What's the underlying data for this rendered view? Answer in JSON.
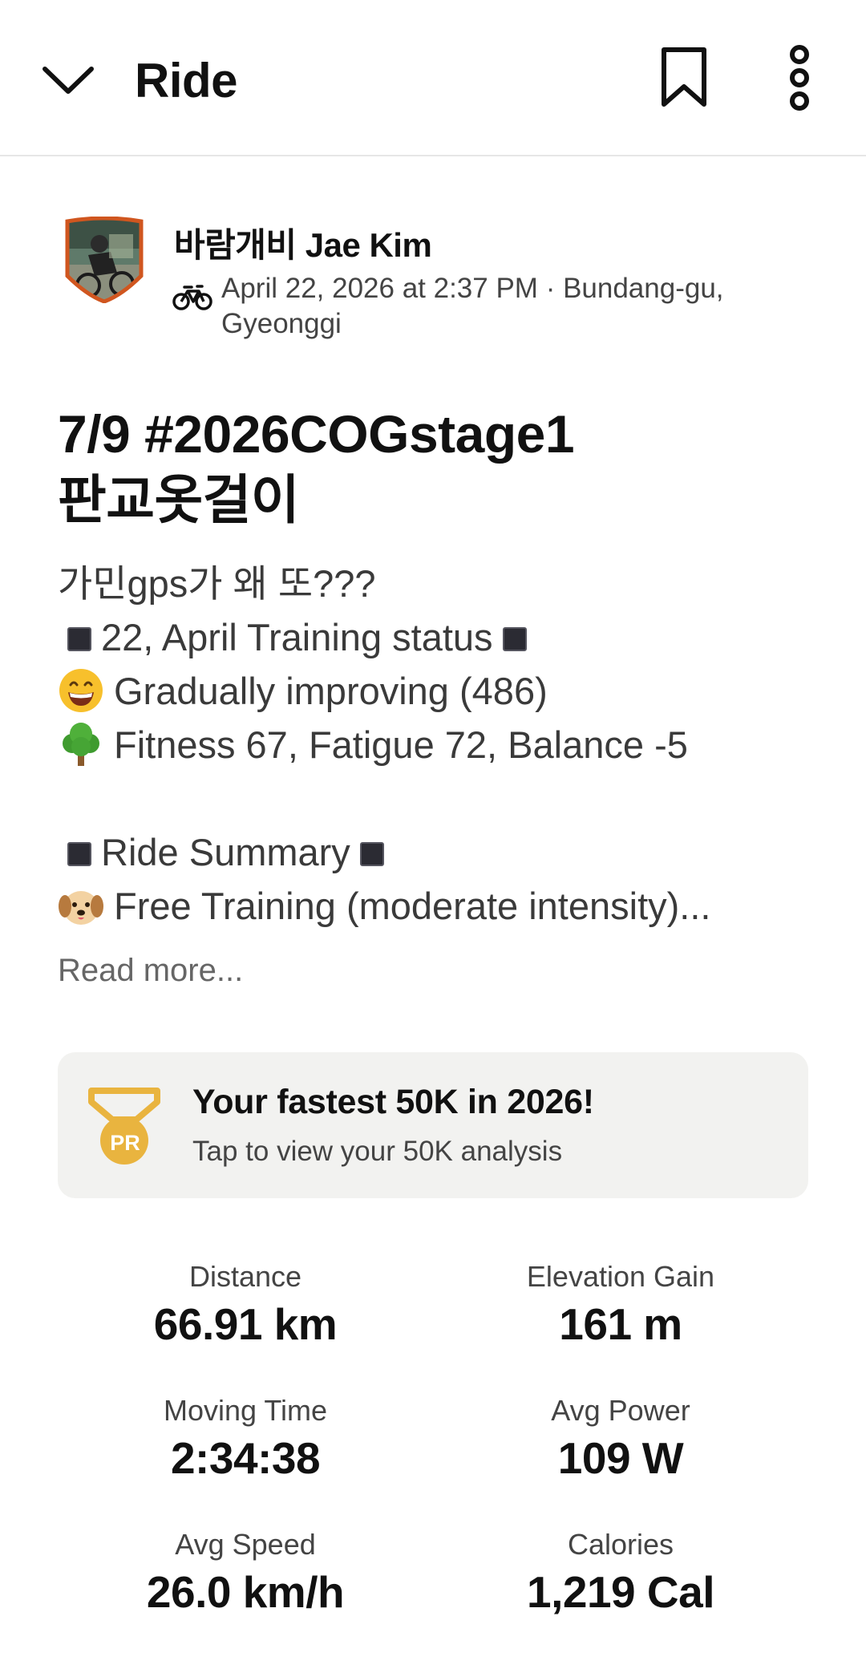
{
  "header": {
    "title": "Ride",
    "collapse_icon": "chevron-down-icon",
    "bookmark_icon": "bookmark-icon",
    "more_icon": "more-vertical-icon"
  },
  "athlete": {
    "name": "바람개비 Jae Kim",
    "activity_icon": "bike-icon",
    "meta": "April 22, 2026 at 2:37 PM · Bundang-gu, Gyeonggi"
  },
  "activity": {
    "title_line1": "7/9 #2026COGstage1",
    "title_line2": "판교옷걸이",
    "description": {
      "line1": "가민gps가  왜 또???",
      "line2": "22, April Training status",
      "line3": "Gradually improving (486)",
      "line4": "Fitness 67, Fatigue 72, Balance -5",
      "line5": "Ride Summary",
      "line6": "Free Training (moderate intensity)..."
    },
    "read_more": "Read more..."
  },
  "pr_card": {
    "icon": "pr-medal-icon",
    "badge_text": "PR",
    "title": "Your fastest 50K in 2026!",
    "subtitle": "Tap to view your 50K analysis",
    "accent": "#e9b43f"
  },
  "stats": [
    {
      "label": "Distance",
      "value": "66.91 km"
    },
    {
      "label": "Elevation Gain",
      "value": "161 m"
    },
    {
      "label": "Moving Time",
      "value": "2:34:38"
    },
    {
      "label": "Avg Power",
      "value": "109 W"
    },
    {
      "label": "Avg Speed",
      "value": "26.0 km/h"
    },
    {
      "label": "Calories",
      "value": "1,219 Cal"
    }
  ]
}
